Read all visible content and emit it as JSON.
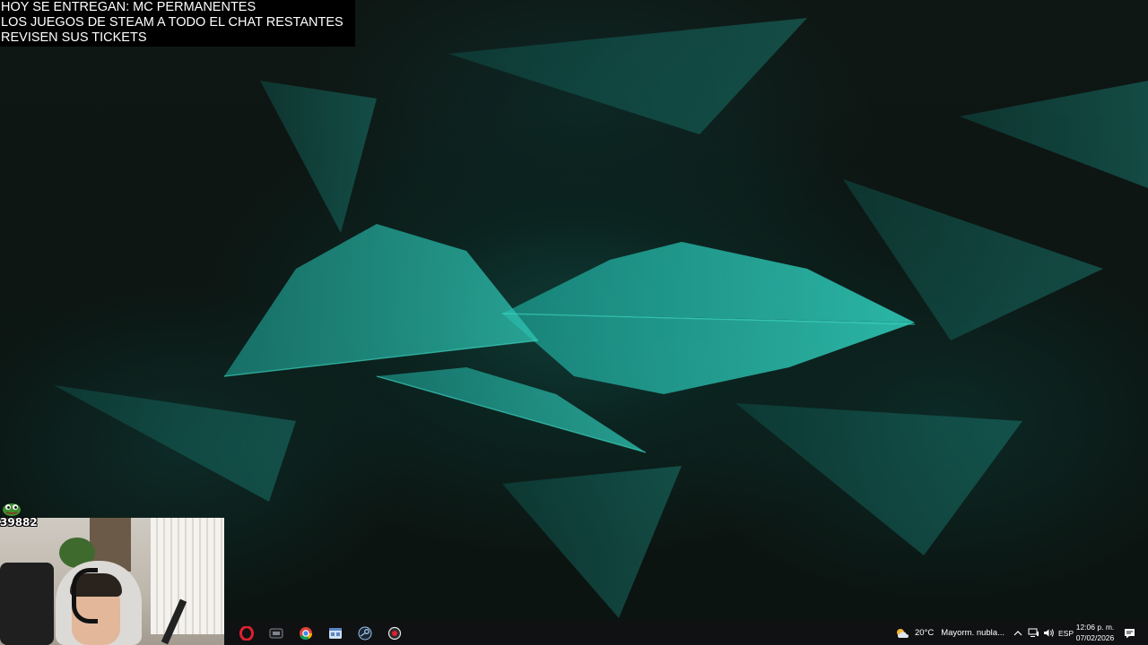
{
  "overlay": {
    "line1": "HOY SE ENTREGAN: MC PERMANENTES",
    "line2": "LOS JUEGOS DE STEAM A TODO EL CHAT RESTANTES",
    "line3": "REVISEN SUS TICKETS"
  },
  "counter": {
    "value": "39882"
  },
  "taskbar": {
    "apps": [
      {
        "icon": "opera-icon",
        "color": "#e0202e"
      },
      {
        "icon": "lunar-launcher-icon",
        "color": "#9aa0a8"
      },
      {
        "icon": "chrome-icon",
        "color": "#34a853"
      },
      {
        "icon": "file-manager-icon",
        "color": "#b9d6f2"
      },
      {
        "icon": "steam-icon",
        "color": "#9ec3e6"
      },
      {
        "icon": "obs-record-icon",
        "color": "#e0202e"
      }
    ],
    "weather": {
      "temp": "20°C",
      "desc": "Mayorm. nubla..."
    },
    "language": "ESP",
    "time": "12:06 p. m.",
    "date": "07/02/2026"
  }
}
